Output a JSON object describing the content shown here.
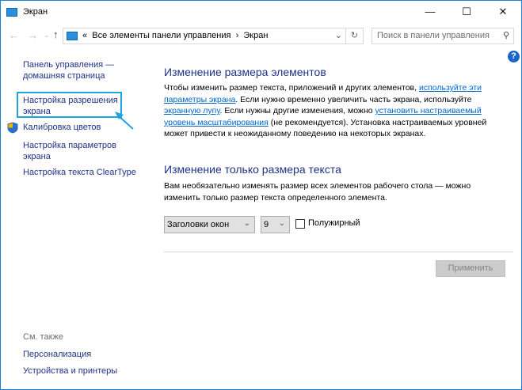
{
  "window": {
    "title": "Экран"
  },
  "address": {
    "prefix": "«",
    "path": [
      "Все элементы панели управления",
      "Экран"
    ],
    "separator": "›"
  },
  "search": {
    "placeholder": "Поиск в панели управления"
  },
  "sidebar": {
    "items": [
      {
        "lines": [
          "Панель управления —",
          "домашняя страница"
        ]
      },
      {
        "lines": [
          "Настройка разрешения",
          "экрана"
        ],
        "highlighted": true
      },
      {
        "lines": [
          "Калибровка цветов"
        ],
        "icon": "shield-icon"
      },
      {
        "lines": [
          "Настройка параметров",
          "экрана"
        ]
      },
      {
        "lines": [
          "Настройка текста ClearType"
        ]
      }
    ],
    "see_also": "См. также",
    "see_also_items": [
      "Персонализация",
      "Устройства и принтеры"
    ]
  },
  "main": {
    "section1": {
      "title": "Изменение размера элементов",
      "lines": [
        [
          {
            "t": "Чтобы изменить размер текста, приложений и других элементов, "
          },
          {
            "t": "используйте эти",
            "link": true
          }
        ],
        [
          {
            "t": "параметры экрана",
            "link": true
          },
          {
            "t": ". Если нужно временно увеличить часть экрана, используйте"
          }
        ],
        [
          {
            "t": "экранную лупу",
            "link": true
          },
          {
            "t": ". Если нужны другие изменения, можно "
          },
          {
            "t": "установить настраиваемый",
            "link": true
          }
        ],
        [
          {
            "t": "уровень масштабирования",
            "link": true
          },
          {
            "t": " (не рекомендуется). Установка настраиваемых уровней"
          }
        ],
        [
          {
            "t": "может привести к неожиданному поведению на некоторых экранах."
          }
        ]
      ]
    },
    "section2": {
      "title": "Изменение только размера текста",
      "lines": [
        "Вам необязательно изменять размер всех элементов рабочего стола — можно",
        "изменить только размер текста определенного элемента."
      ]
    },
    "element_select": "Заголовки окон",
    "size_select": "9",
    "bold_label": "Полужирный",
    "bold_checked": false,
    "apply_label": "Применить"
  },
  "colors": {
    "accent": "#1883d7",
    "link": "#0066cc",
    "heading": "#1e3287"
  }
}
